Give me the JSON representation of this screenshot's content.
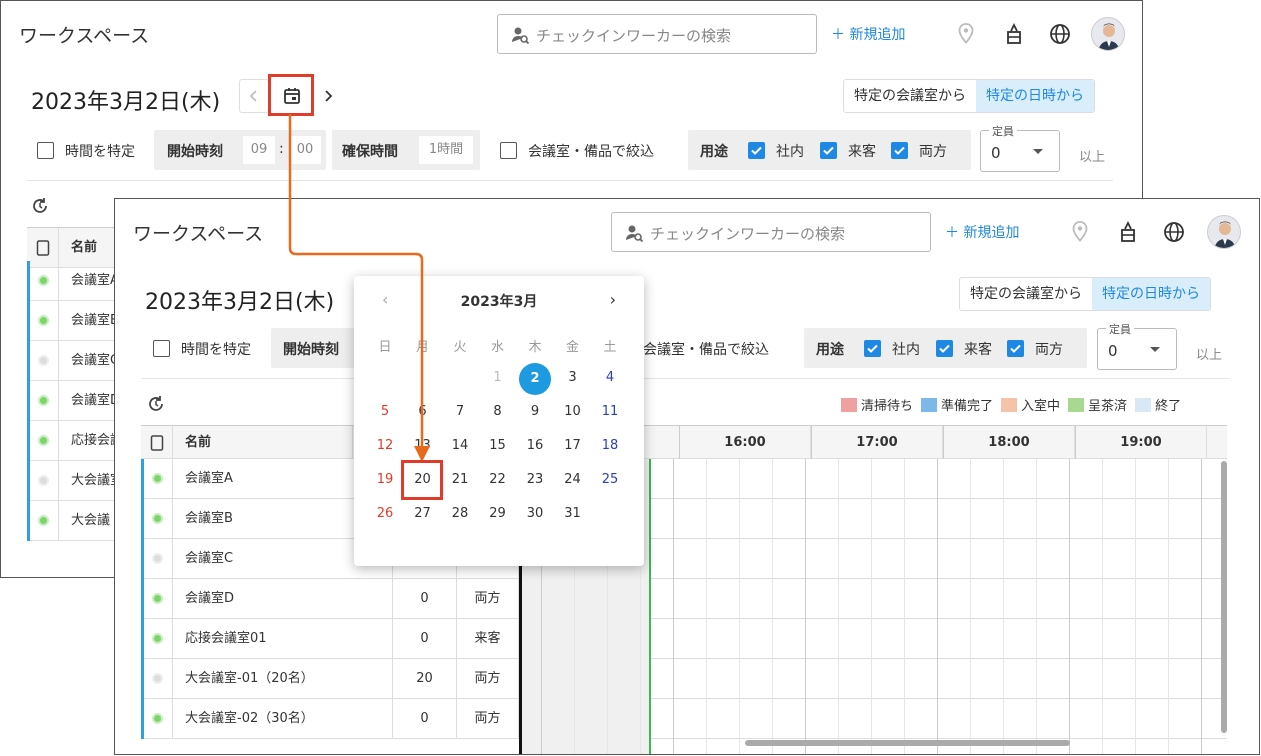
{
  "app": {
    "title": "ワークスペース",
    "search_placeholder": "チェックインワーカーの検索",
    "add_label": "＋ 新規追加"
  },
  "date_label": "2023年3月2日(木)",
  "mode_tabs": {
    "room": "特定の会議室から",
    "datetime": "特定の日時から"
  },
  "filters": {
    "time_specify": "時間を特定",
    "start_time_label": "開始時刻",
    "hour": "09",
    "colon": ":",
    "minute": "00",
    "duration_label": "確保時間",
    "duration_value": "1時間",
    "room_filter": "会議室・備品で絞込",
    "usage_label": "用途",
    "usage_internal": "社内",
    "usage_guest": "来客",
    "usage_both": "両方",
    "capacity_caption": "定員",
    "capacity_value": "0",
    "capacity_suffix": "以上"
  },
  "legend": [
    {
      "label": "清掃待ち",
      "color": "#f0a0a0"
    },
    {
      "label": "準備完了",
      "color": "#7cb8ea"
    },
    {
      "label": "入室中",
      "color": "#f5c4a8"
    },
    {
      "label": "呈茶済",
      "color": "#a9d990"
    },
    {
      "label": "終了",
      "color": "#d9e8f7"
    }
  ],
  "table": {
    "name_header": "名前",
    "times": [
      "16:00",
      "17:00",
      "18:00",
      "19:00"
    ],
    "rows": [
      {
        "name": "会議室A",
        "capacity": "",
        "usage": "",
        "status": "green",
        "bar": true
      },
      {
        "name": "会議室B",
        "capacity": "",
        "usage": "",
        "status": "green",
        "bar": true
      },
      {
        "name": "会議室C",
        "capacity": "",
        "usage": "",
        "status": "gray",
        "bar": true
      },
      {
        "name": "会議室D",
        "capacity": "0",
        "usage": "両方",
        "status": "green",
        "bar": true
      },
      {
        "name": "応接会議室01",
        "capacity": "0",
        "usage": "来客",
        "status": "green",
        "bar": true
      },
      {
        "name": "大会議室-01（20名）",
        "capacity": "20",
        "usage": "両方",
        "status": "gray",
        "bar": true
      },
      {
        "name": "大会議室-02（30名）",
        "capacity": "0",
        "usage": "両方",
        "status": "green",
        "bar": true
      }
    ],
    "back_rows": [
      {
        "name": "会議室A",
        "status": "green"
      },
      {
        "name": "会議室B",
        "status": "green"
      },
      {
        "name": "会議室C",
        "status": "gray"
      },
      {
        "name": "会議室D",
        "status": "green"
      },
      {
        "name": "応接会議",
        "status": "green"
      },
      {
        "name": "大会議室",
        "status": "gray"
      },
      {
        "name": "大会議",
        "status": "green"
      }
    ]
  },
  "calendar": {
    "title": "2023年3月",
    "prev": "‹",
    "next": "›",
    "weekdays": [
      "日",
      "月",
      "火",
      "水",
      "木",
      "金",
      "土"
    ],
    "weeks": [
      [
        "",
        "",
        "",
        "1",
        "2",
        "3",
        "4"
      ],
      [
        "5",
        "6",
        "7",
        "8",
        "9",
        "10",
        "11"
      ],
      [
        "12",
        "13",
        "14",
        "15",
        "16",
        "17",
        "18"
      ],
      [
        "19",
        "20",
        "21",
        "22",
        "23",
        "24",
        "25"
      ],
      [
        "26",
        "27",
        "28",
        "29",
        "30",
        "31",
        ""
      ]
    ],
    "selected": "2",
    "highlighted": "20",
    "colors": {
      "sunday": "#e03c2c",
      "saturday": "#2a3fc0",
      "selected": "#1e9be0",
      "accent": "#e86a1a"
    }
  }
}
